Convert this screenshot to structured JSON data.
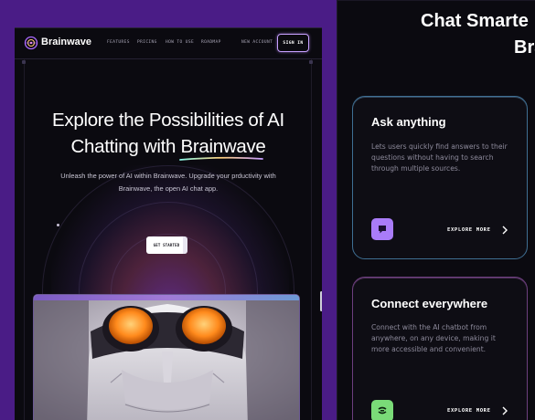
{
  "header": {
    "brand": "Brainwave",
    "nav": [
      "FEATURES",
      "PRICING",
      "HOW TO USE",
      "ROADMAP"
    ],
    "new_account": "NEW ACCOUNT",
    "sign_in": "SIGN IN"
  },
  "hero": {
    "title_line1": "Explore the Possibilities of  AI",
    "title_line2_prefix": "Chatting with ",
    "title_line2_highlight": "Brainwave",
    "subtitle_line1": "Unleash the power of AI within Brainwave. Upgrade your prductivity with",
    "subtitle_line2": "Brainwave, the open AI chat app.",
    "cta": "GET STARTED"
  },
  "right": {
    "heading_line1": "Chat Smarte",
    "heading_line2": "Bra",
    "cards": [
      {
        "title": "Ask anything",
        "text": "Lets users quickly find answers to their questions without having to search through multiple sources.",
        "link": "EXPLORE MORE",
        "icon": "chat-bubble-icon",
        "icon_color": "#a97cf8"
      },
      {
        "title": "Connect everywhere",
        "text": "Connect with the AI chatbot from anywhere, on any device, making it more accessible and convenient.",
        "link": "EXPLORE MORE",
        "icon": "connect-icon",
        "icon_color": "#7adb78"
      }
    ]
  },
  "colors": {
    "frame_purple": "#4a1c86",
    "background": "#0b0a10",
    "accent_purple": "#ac6aff",
    "card1_border": "#3f6f93",
    "card2_border": "#6d3f7f"
  }
}
